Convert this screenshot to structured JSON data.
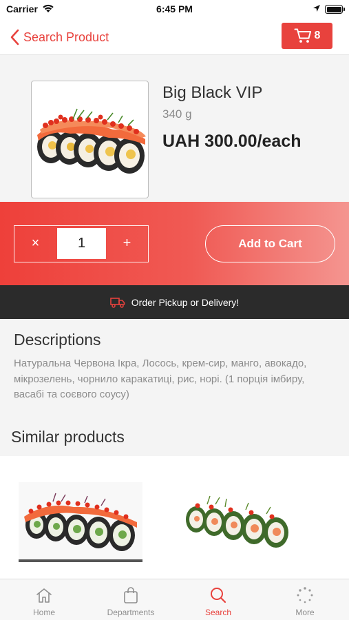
{
  "status_bar": {
    "carrier": "Carrier",
    "time": "6:45 PM"
  },
  "nav": {
    "back_label": "Search Product",
    "cart_count": "8"
  },
  "product": {
    "name": "Big Black VIP",
    "weight": "340 g",
    "price": "UAH 300.00/each",
    "quantity": "1",
    "add_to_cart_label": "Add to Cart"
  },
  "delivery": {
    "label": "Order Pickup or Delivery!"
  },
  "descriptions": {
    "title": "Descriptions",
    "text": "Натуральна Червона Ікра, Лосось, крем-сир, манго, авокадо, мікрозелень, чорнило каракатиці, рис, норі. (1 порція імбиру, васабі та соєвого соусу)"
  },
  "similar": {
    "title": "Similar products"
  },
  "tabs": [
    {
      "label": "Home",
      "icon": "home-icon"
    },
    {
      "label": "Departments",
      "icon": "bag-icon"
    },
    {
      "label": "Search",
      "icon": "search-icon"
    },
    {
      "label": "More",
      "icon": "more-icon"
    }
  ],
  "colors": {
    "accent": "#e8423d",
    "delivery_bar": "#2b2b2b"
  }
}
